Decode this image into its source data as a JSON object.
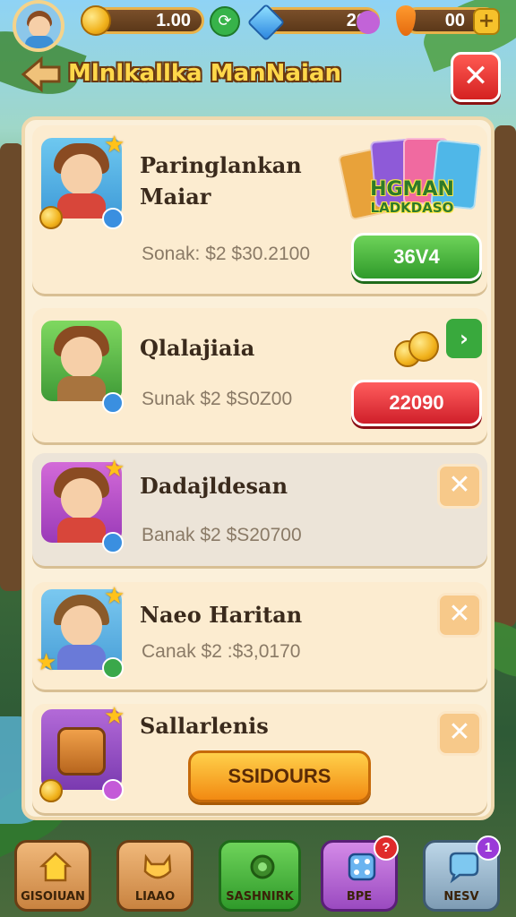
{
  "header": {
    "coins_value": "1.00",
    "gems_value": "20",
    "carrots_value": "00",
    "plus_label": "+"
  },
  "title_bar": {
    "title": "Mlnlkallka ManNaian",
    "close_label": "✕"
  },
  "promo": {
    "line1": "HGMAN",
    "line2": "LADKDASO"
  },
  "items": [
    {
      "name_line1": "Paringlankan",
      "name_line2": "Maiar",
      "price": "Sonak: $2  $30.2100",
      "button_label": "36V4",
      "button_style": "green"
    },
    {
      "name_line1": "Qlalajiaia",
      "name_line2": "",
      "price": "Sunak  $2  $S0Z00",
      "button_label": "22090",
      "button_style": "red"
    },
    {
      "name_line1": "Dadajldesan",
      "name_line2": "",
      "price": "Banak  $2  $S20700"
    },
    {
      "name_line1": "Naeo Haritan",
      "name_line2": "",
      "price": "Canak  $2  :$3,0170"
    },
    {
      "name_line1": "Sallarlenis",
      "name_line2": "",
      "button_label": "SSIDOURS",
      "button_style": "orange"
    }
  ],
  "bottom_nav": [
    {
      "label": "GISOIUAN",
      "icon": "house-icon"
    },
    {
      "label": "LIAAO",
      "icon": "cat-icon"
    },
    {
      "label": "SASHNIRK",
      "icon": "gear-icon"
    },
    {
      "label": "BPE",
      "icon": "dice-icon",
      "badge": "?"
    },
    {
      "label": "NESV",
      "icon": "chat-icon",
      "badge": "1"
    }
  ],
  "colors": {
    "accent_gold": "#ffd84a",
    "green_button": "#2f9a2a",
    "red_button": "#cf1f2a",
    "orange_button": "#f28a12",
    "panel_bg": "#fbf0da"
  }
}
